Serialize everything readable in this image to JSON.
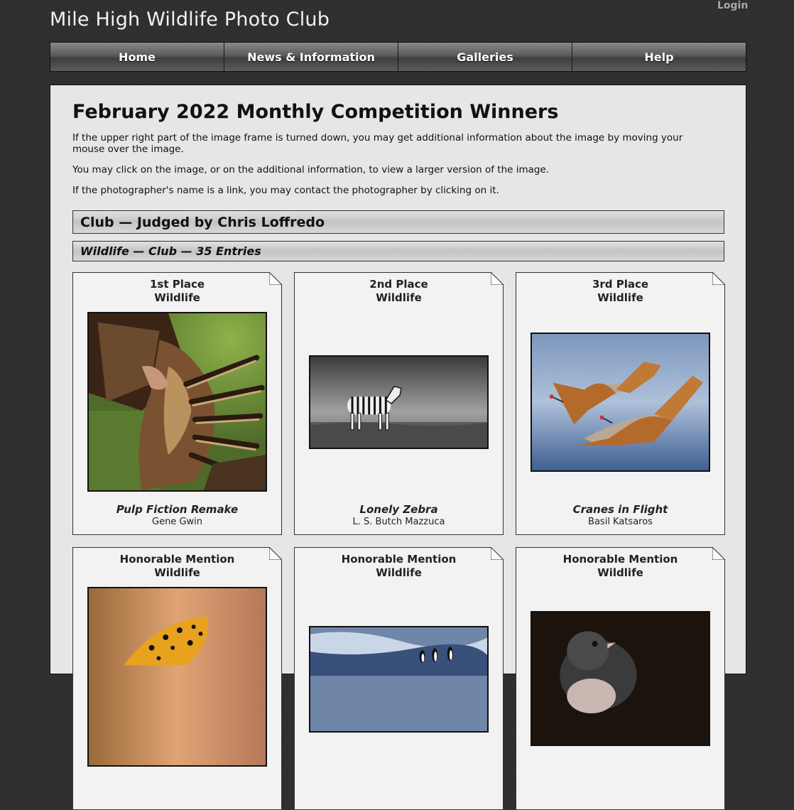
{
  "header": {
    "login_label": "Login",
    "site_title": "Mile High Wildlife Photo Club"
  },
  "nav": {
    "items": [
      {
        "label": "Home"
      },
      {
        "label": "News & Information"
      },
      {
        "label": "Galleries"
      },
      {
        "label": "Help"
      }
    ]
  },
  "main": {
    "title": "February 2022 Monthly Competition Winners",
    "paragraphs": [
      "If the upper right part of the image frame is turned down, you may get additional information about the image by moving your mouse over the image.",
      "You may click on the image, or on the additional information, to view a larger version of the image.",
      "If the photographer's name is a link, you may contact the photographer by clicking on it."
    ],
    "section_heading": "Club — Judged by Chris Loffredo",
    "category_heading": "Wildlife — Club — 35 Entries",
    "entries": [
      {
        "place": "1st Place",
        "category": "Wildlife",
        "title": "Pulp Fiction Remake",
        "photographer": "Gene Gwin",
        "image_subject": "vulture-spreading-wings"
      },
      {
        "place": "2nd Place",
        "category": "Wildlife",
        "title": "Lonely Zebra",
        "photographer": "L. S. Butch Mazzuca",
        "image_subject": "zebra-black-and-white"
      },
      {
        "place": "3rd Place",
        "category": "Wildlife",
        "title": "Cranes in Flight",
        "photographer": "Basil Katsaros",
        "image_subject": "sandhill-cranes-flying"
      },
      {
        "place": "Honorable Mention",
        "category": "Wildlife",
        "title": "",
        "photographer": "",
        "image_subject": "butterfly"
      },
      {
        "place": "Honorable Mention",
        "category": "Wildlife",
        "title": "",
        "photographer": "",
        "image_subject": "penguins"
      },
      {
        "place": "Honorable Mention",
        "category": "Wildlife",
        "title": "",
        "photographer": "",
        "image_subject": "junco-bird"
      }
    ]
  }
}
